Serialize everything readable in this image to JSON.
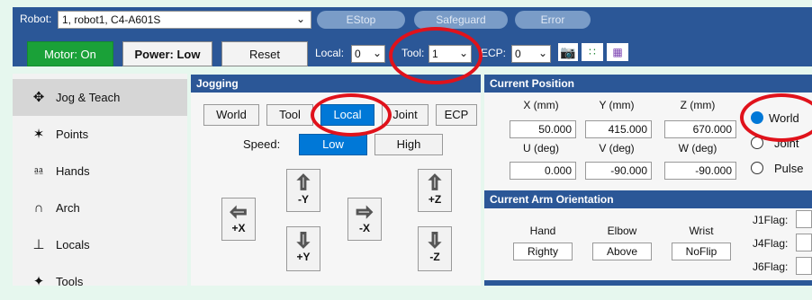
{
  "topbar": {
    "robot_label": "Robot:",
    "robot_value": "1, robot1, C4-A601S",
    "estop": "EStop",
    "safeguard": "Safeguard",
    "error": "Error",
    "motor": "Motor: On",
    "power": "Power: Low",
    "reset": "Reset",
    "local_label": "Local:",
    "local_value": "0",
    "tool_label": "Tool:",
    "tool_value": "1",
    "ecp_label": "ECP:",
    "ecp_value": "0"
  },
  "sidebar": {
    "items": [
      {
        "label": "Jog & Teach",
        "icon": "move-icon"
      },
      {
        "label": "Points",
        "icon": "points-icon"
      },
      {
        "label": "Hands",
        "icon": "hand-icon"
      },
      {
        "label": "Arch",
        "icon": "arch-icon"
      },
      {
        "label": "Locals",
        "icon": "locals-icon"
      },
      {
        "label": "Tools",
        "icon": "tools-icon"
      }
    ]
  },
  "jogging": {
    "title": "Jogging",
    "modes": [
      "World",
      "Tool",
      "Local",
      "Joint",
      "ECP"
    ],
    "selected_mode": "Local",
    "speed_label": "Speed:",
    "speed_low": "Low",
    "speed_high": "High",
    "buttons": {
      "neg_y": "-Y",
      "pos_y": "+Y",
      "pos_x": "+X",
      "neg_x": "-X",
      "pos_z": "+Z",
      "neg_z": "-Z"
    }
  },
  "position": {
    "title": "Current Position",
    "x_label": "X (mm)",
    "y_label": "Y (mm)",
    "z_label": "Z (mm)",
    "x": "50.000",
    "y": "415.000",
    "z": "670.000",
    "u_label": "U (deg)",
    "v_label": "V (deg)",
    "w_label": "W (deg)",
    "u": "0.000",
    "v": "-90.000",
    "w": "-90.000",
    "radio_world": "World",
    "radio_joint": "Joint",
    "radio_pulse": "Pulse"
  },
  "orientation": {
    "title": "Current Arm Orientation",
    "hand_label": "Hand",
    "elbow_label": "Elbow",
    "wrist_label": "Wrist",
    "hand": "Righty",
    "elbow": "Above",
    "wrist": "NoFlip",
    "j1": "J1Flag:",
    "j4": "J4Flag:",
    "j6": "J6Flag:"
  },
  "colors": {
    "accent": "#2b5797",
    "selected": "#0078d7",
    "motor_on": "#1aa138",
    "highlight": "#e0121b",
    "arrow": "#f2c300"
  }
}
